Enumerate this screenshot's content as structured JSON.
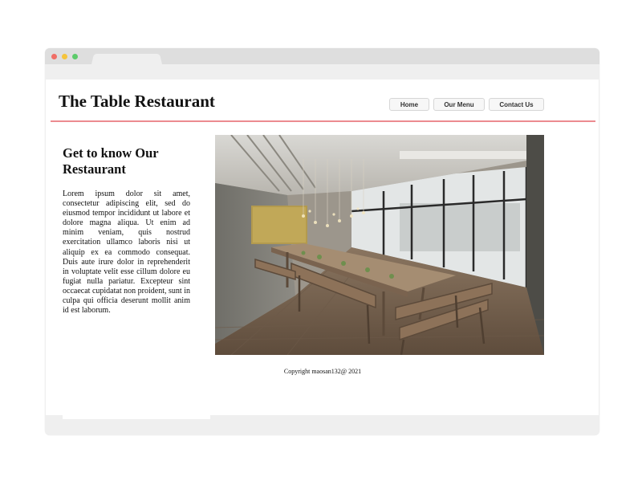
{
  "site": {
    "title": "The Table Restaurant",
    "nav": [
      {
        "label": "Home"
      },
      {
        "label": "Our Menu"
      },
      {
        "label": "Contact Us"
      }
    ]
  },
  "about": {
    "heading": "Get to know Our Restaurant",
    "body": "Lorem ipsum dolor sit amet, consectetur adipiscing elit, sed do eiusmod tempor incididunt ut labore et dolore magna aliqua. Ut enim ad minim veniam, quis nostrud exercitation ullamco laboris nisi ut aliquip ex ea commodo consequat. Duis aute irure dolor in reprehenderit in voluptate velit esse cillum dolore eu fugiat nulla pariatur. Excepteur sint occaecat cupidatat non proident, sunt in culpa qui officia deserunt mollit anim id est laborum."
  },
  "footer": {
    "copyright": "Copyright maosan132@ 2021"
  },
  "colors": {
    "divider": "#ec8b90",
    "window_chrome": "#dedede",
    "close": "#f06e66",
    "minimize": "#f5c43c",
    "maximize": "#5ccb6a"
  }
}
